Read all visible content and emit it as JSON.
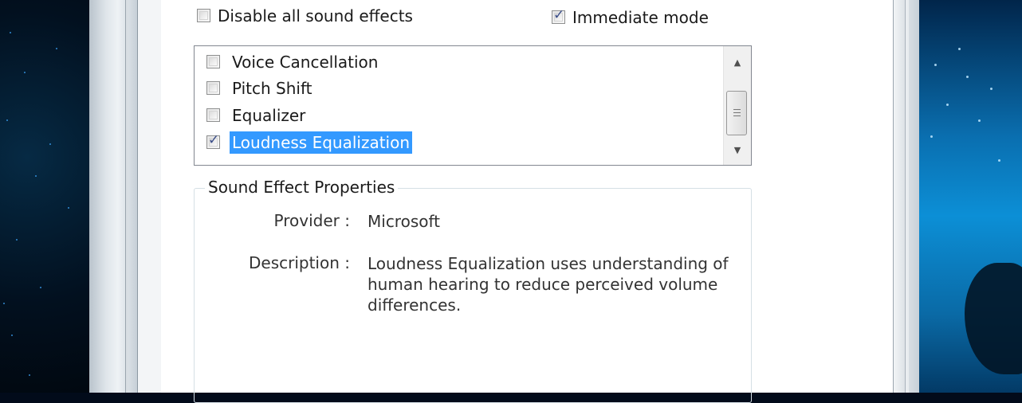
{
  "top_options": {
    "disable_all_label": "Disable all sound effects",
    "disable_all_checked": false,
    "immediate_mode_label": "Immediate mode",
    "immediate_mode_checked": true
  },
  "effects_list": {
    "items": [
      {
        "label": "Voice Cancellation",
        "checked": false,
        "selected": false
      },
      {
        "label": "Pitch Shift",
        "checked": false,
        "selected": false
      },
      {
        "label": "Equalizer",
        "checked": false,
        "selected": false
      },
      {
        "label": "Loudness Equalization",
        "checked": true,
        "selected": true
      }
    ],
    "scroll_up_icon": "triangle-up",
    "scroll_down_icon": "triangle-down"
  },
  "properties": {
    "title": "Sound Effect Properties",
    "provider_label": "Provider :",
    "provider_value": "Microsoft",
    "description_label": "Description :",
    "description_lines": [
      "Loudness Equalization uses understanding of",
      "human hearing to reduce perceived volume",
      "differences."
    ]
  },
  "colors": {
    "selection": "#3399ff",
    "check": "#3b4e89"
  }
}
